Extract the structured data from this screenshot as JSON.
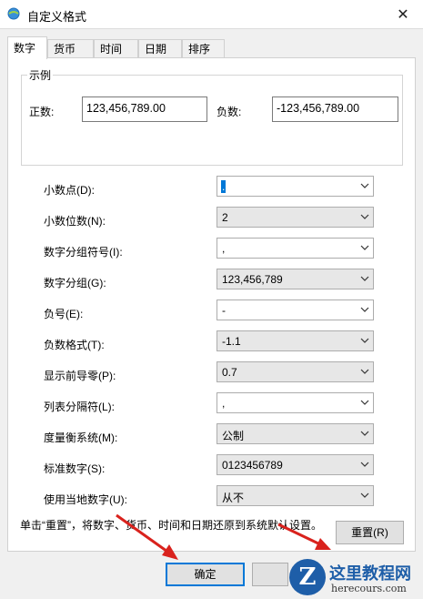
{
  "window": {
    "title": "自定义格式"
  },
  "tabs": [
    {
      "label": "数字",
      "active": true
    },
    {
      "label": "货币"
    },
    {
      "label": "时间"
    },
    {
      "label": "日期"
    },
    {
      "label": "排序"
    }
  ],
  "sample": {
    "group_label": "示例",
    "positive_label": "正数:",
    "positive_value": "123,456,789.00",
    "negative_label": "负数:",
    "negative_value": "-123,456,789.00"
  },
  "settings": [
    {
      "label": "小数点(D):",
      "value": "."
    },
    {
      "label": "小数位数(N):",
      "value": "2"
    },
    {
      "label": "数字分组符号(I):",
      "value": ","
    },
    {
      "label": "数字分组(G):",
      "value": "123,456,789"
    },
    {
      "label": "负号(E):",
      "value": "-"
    },
    {
      "label": "负数格式(T):",
      "value": "-1.1"
    },
    {
      "label": "显示前导零(P):",
      "value": "0.7"
    },
    {
      "label": "列表分隔符(L):",
      "value": ","
    },
    {
      "label": "度量衡系统(M):",
      "value": "公制"
    },
    {
      "label": "标准数字(S):",
      "value": "0123456789"
    },
    {
      "label": "使用当地数字(U):",
      "value": "从不"
    }
  ],
  "note": "单击“重置”，将数字、货币、时间和日期还原到系统默认设置。",
  "buttons": {
    "reset": "重置(R)",
    "ok": "确定"
  },
  "watermark": {
    "logo_letter": "Z",
    "title": "这里教程网",
    "url": "herecours.com"
  },
  "colors": {
    "accent": "#0078d7",
    "annotation_arrow": "#d9221d",
    "watermark_blue": "#1e5ea8"
  }
}
